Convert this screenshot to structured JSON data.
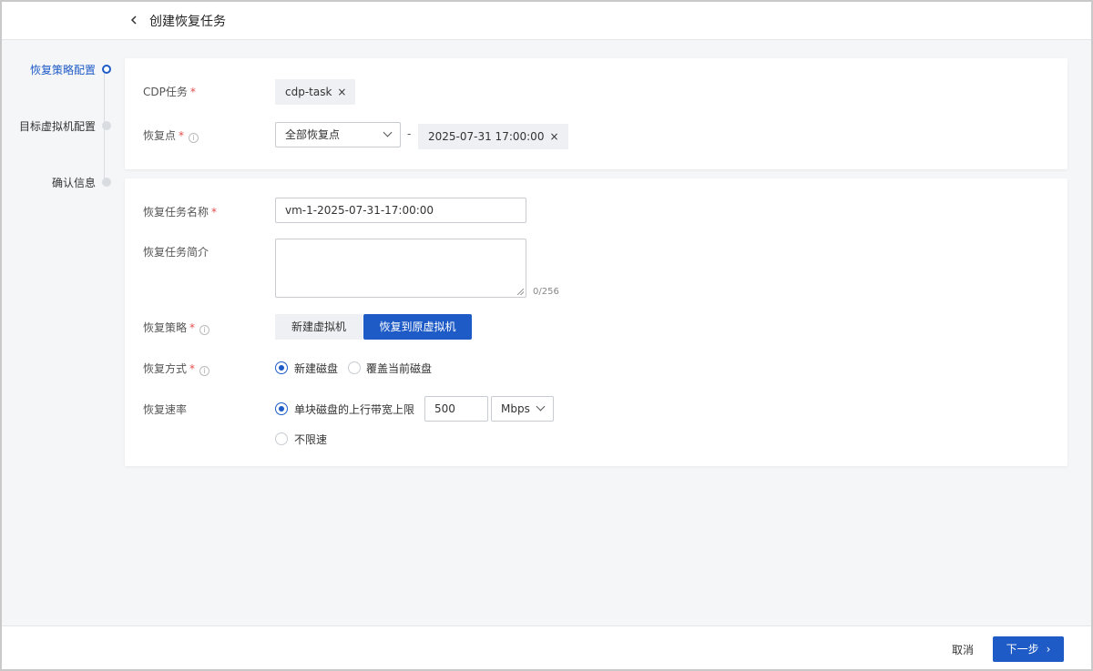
{
  "header": {
    "title": "创建恢复任务"
  },
  "steps": [
    {
      "label": "恢复策略配置",
      "active": true
    },
    {
      "label": "目标虚拟机配置",
      "active": false
    },
    {
      "label": "确认信息",
      "active": false
    }
  ],
  "source": {
    "cdp_task_label": "CDP任务",
    "cdp_task_tag": "cdp-task",
    "restore_point_label": "恢复点",
    "restore_point_select": "全部恢复点",
    "restore_point_dash": "-",
    "restore_point_tag": "2025-07-31 17:00:00"
  },
  "task": {
    "name_label": "恢复任务名称",
    "name_value": "vm-1-2025-07-31-17:00:00",
    "desc_label": "恢复任务简介",
    "desc_counter": "0/256",
    "strategy_label": "恢复策略",
    "strategy_options": [
      "新建虚拟机",
      "恢复到原虚拟机"
    ],
    "strategy_selected": "恢复到原虚拟机",
    "mode_label": "恢复方式",
    "mode_options": [
      "新建磁盘",
      "覆盖当前磁盘"
    ],
    "mode_selected": "新建磁盘",
    "rate_label": "恢复速率",
    "rate_option_limit": "单块磁盘的上行带宽上限",
    "rate_value": "500",
    "rate_unit": "Mbps",
    "rate_option_unlimited": "不限速"
  },
  "footer": {
    "cancel_label": "取消",
    "next_label": "下一步"
  },
  "required_mark": "*",
  "info_icon_glyph": "i",
  "close_glyph": "×",
  "next_arrow_glyph": "›",
  "colors": {
    "accent": "#1e5bc6",
    "required": "#e34d4d"
  }
}
